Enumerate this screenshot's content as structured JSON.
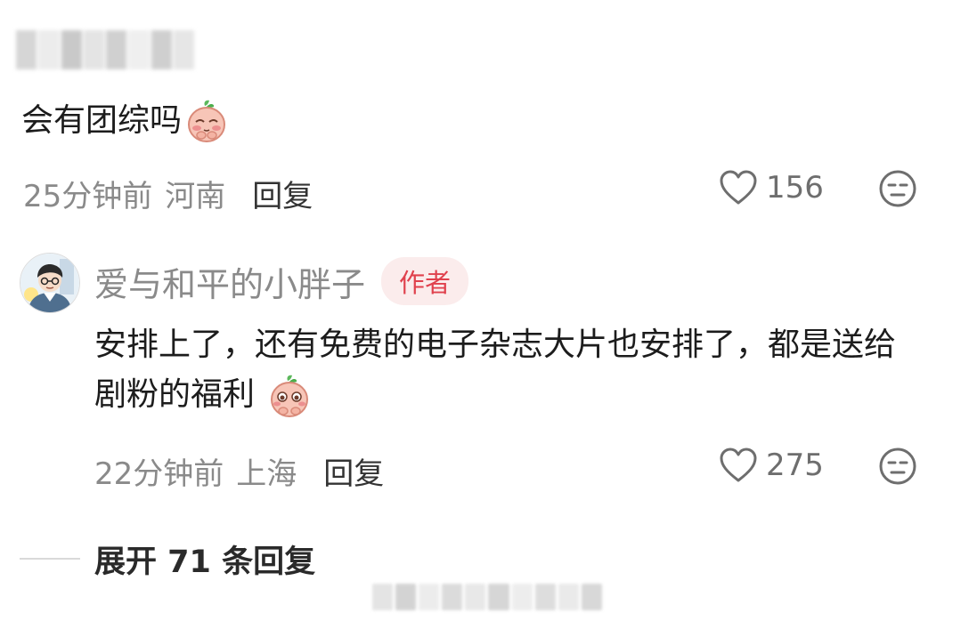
{
  "comment1": {
    "text": "会有团综吗",
    "time": "25分钟前",
    "location": "河南",
    "reply_label": "回复",
    "likes": "156",
    "emoji": "peach-pleading-emoji"
  },
  "reply": {
    "author": "爱与和平的小胖子",
    "badge": "作者",
    "text": "安排上了，还有免费的电子杂志大片也安排了，都是送给剧粉的福利",
    "time": "22分钟前",
    "location": "上海",
    "reply_label": "回复",
    "likes": "275",
    "emoji": "peach-shy-emoji"
  },
  "expand": {
    "label": "展开 71 条回复"
  },
  "colors": {
    "meta": "#8a8a8a",
    "badge_bg": "#fbecec",
    "badge_text": "#e0414d",
    "icon_stroke": "#6e6e6e"
  },
  "icons": [
    "heart-outline-icon",
    "neutral-face-icon",
    "avatar-illustration"
  ]
}
